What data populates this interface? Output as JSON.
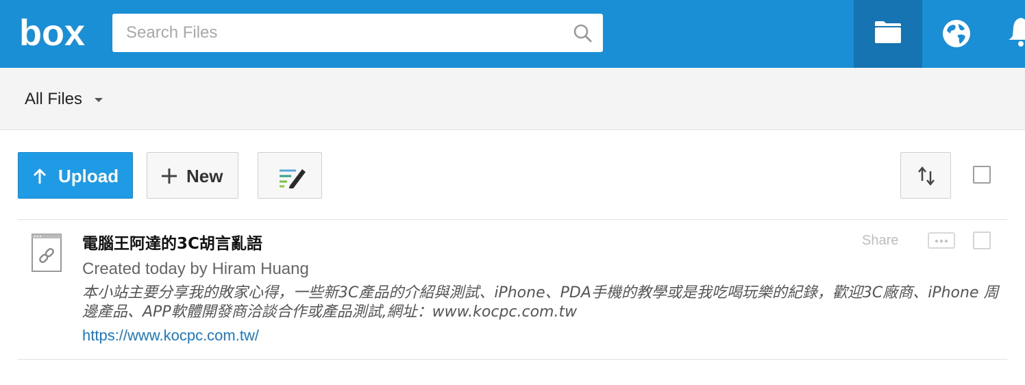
{
  "header": {
    "logo_text": "box",
    "search_placeholder": "Search Files",
    "nav": [
      {
        "name": "folder-icon",
        "active": true
      },
      {
        "name": "globe-icon",
        "active": false
      },
      {
        "name": "bell-icon",
        "active": false
      }
    ],
    "colors": {
      "bar": "#1a8fd6",
      "active_nav": "#1774b3"
    }
  },
  "breadcrumb": {
    "label": "All Files"
  },
  "toolbar": {
    "upload_label": "Upload",
    "new_label": "New",
    "notes_icon": "notes-pen-icon",
    "sort_icon": "sort-arrows-icon",
    "colors": {
      "upload": "#1f9be6"
    }
  },
  "files": [
    {
      "name": "電腦王阿達的3C胡言亂語",
      "meta": "Created today by Hiram Huang",
      "description": "本小站主要分享我的敗家心得，一些新3C產品的介紹與測試、iPhone、PDA手機的教學或是我吃喝玩樂的紀錄，歡迎3C廠商、iPhone 周邊產品、APP軟體開發商洽談合作或產品測試,網址：www.kocpc.com.tw",
      "url": "https://www.kocpc.com.tw/",
      "share_label": "Share",
      "icon": "web-link-icon"
    }
  ]
}
